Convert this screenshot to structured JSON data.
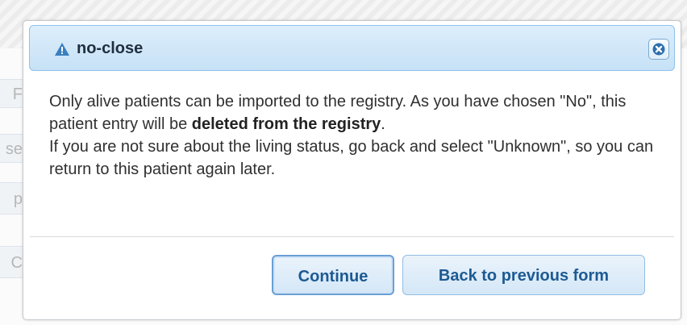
{
  "dialog": {
    "title": "no-close",
    "close_label": "×",
    "message_1_pre": "Only alive patients can be imported to the registry. As you have chosen \"No\", this patient entry will be ",
    "message_1_bold": "deleted from the registry",
    "message_1_post": ".",
    "message_2": "If you are not sure about the living status, go back and select \"Unknown\", so you can return to this patient again later.",
    "buttons": {
      "continue": "Continue",
      "back": "Back to previous form"
    }
  },
  "background": {
    "fragments": [
      "F",
      "se",
      "p",
      "C"
    ]
  },
  "colors": {
    "titlebar_bg": "#c6e1f6",
    "titlebar_border": "#8fc2ea",
    "button_text": "#1d5a93",
    "button_border": "#93bde3"
  },
  "icons": {
    "title_icon": "warning-icon",
    "close_icon": "close-icon"
  }
}
